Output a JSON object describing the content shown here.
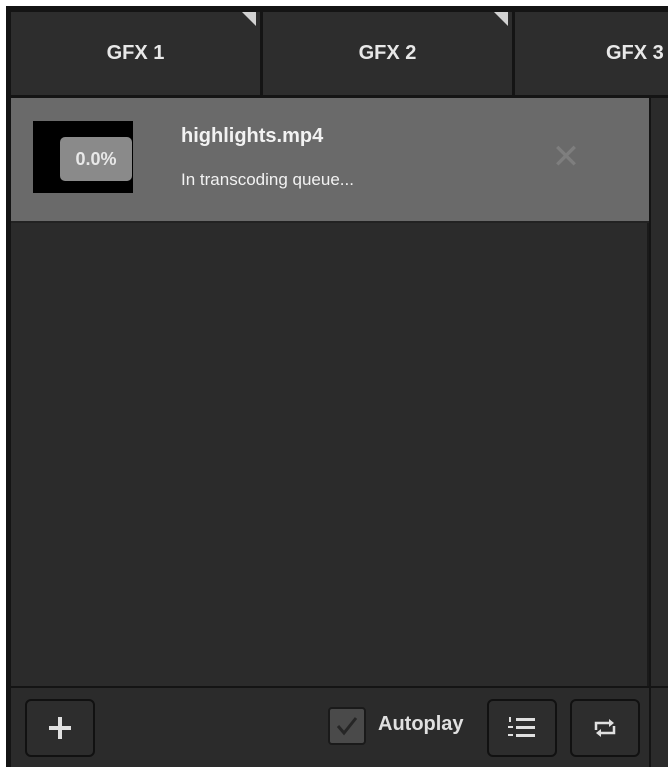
{
  "tabs": [
    {
      "label": "GFX 1"
    },
    {
      "label": "GFX 2"
    },
    {
      "label": "GFX 3"
    }
  ],
  "playlist": {
    "items": [
      {
        "progress": "0.0%",
        "filename": "highlights.mp4",
        "status": "In transcoding queue..."
      }
    ]
  },
  "toolbar": {
    "add_icon": "plus-icon",
    "autoplay_label": "Autoplay",
    "autoplay_checked": true,
    "list_icon": "numbered-list-icon",
    "loop_icon": "loop-icon"
  },
  "colors": {
    "background": "#2b2b2b",
    "tab_bg": "#2d2d2d",
    "selected_item_bg": "#6a6a6a",
    "text": "#f2f2f2"
  }
}
